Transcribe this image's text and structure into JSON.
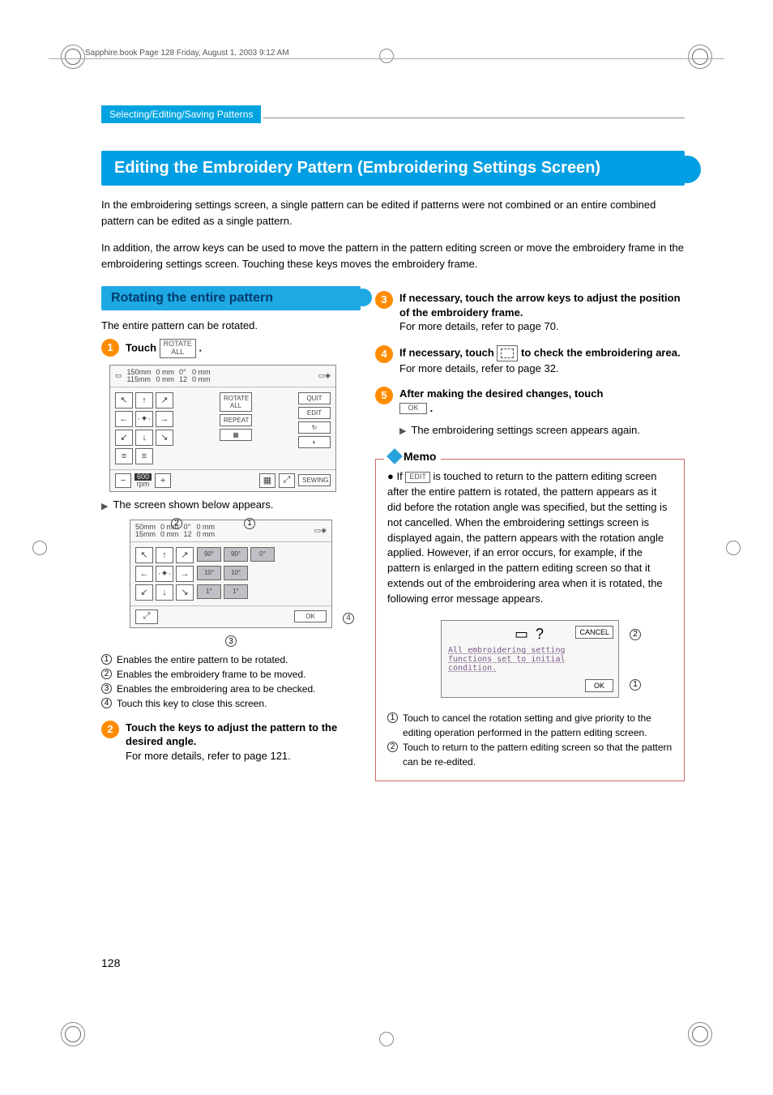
{
  "header": {
    "meta_line": "Sapphire.book  Page 128  Friday, August 1, 2003  9:12 AM",
    "section": "Selecting/Editing/Saving Patterns"
  },
  "title": "Editing the Embroidery Pattern (Embroidering Settings Screen)",
  "intro1": "In the embroidering settings screen, a single pattern can be edited if patterns were not combined or an entire combined pattern can be edited as a single pattern.",
  "intro2": "In addition, the arrow keys can be used to move the pattern in the pattern editing screen or move the embroidery frame in the embroidering settings screen. Touching these keys moves the embroidery frame.",
  "subheading": "Rotating the entire pattern",
  "sub_lead": "The entire pattern can be rotated.",
  "steps": {
    "s1": {
      "num": "1",
      "label": "Touch ",
      "key": "ROTATE\nALL",
      "period": "."
    },
    "s1_result": "The screen shown below appears.",
    "s2": {
      "num": "2",
      "bold": "Touch the keys to adjust the pattern to the desired angle.",
      "detail": "For more details, refer to page 121."
    },
    "s3": {
      "num": "3",
      "bold": "If necessary, touch the arrow keys to adjust the position of the embroidery frame.",
      "detail": "For more details, refer to page 70."
    },
    "s4": {
      "num": "4",
      "bold_a": "If necessary, touch ",
      "bold_b": " to check the embroidering area.",
      "detail": "For more details, refer to page 32."
    },
    "s5": {
      "num": "5",
      "bold_a": "After making the desired changes, touch ",
      "key": "OK",
      "period": ".",
      "result": "The embroidering settings screen appears again."
    }
  },
  "screenshot1": {
    "size1": "150mm",
    "size2": "115mm",
    "mm1": "0  mm",
    "mm2": "0  mm",
    "mm3": "0  mm",
    "mm4": "0  mm",
    "angle": "0°",
    "count": "12",
    "rotate_all": "ROTATE ALL",
    "repeat": "REPEAT",
    "quit": "QUIT",
    "edit": "EDIT",
    "sewing": "SEWING",
    "speed": "600",
    "rpm": "rpm"
  },
  "screenshot2": {
    "size1": "50mm",
    "size2": "15mm",
    "mm1": "0  mm",
    "mm2": "0  mm",
    "mm3": "0  mm",
    "mm4": "0  mm",
    "angle": "0°",
    "count": "12",
    "r90a": "90°",
    "r90b": "90°",
    "r10a": "10°",
    "r10b": "10°",
    "r1a": "1°",
    "r1b": "1°",
    "r0": "0°",
    "ok": "OK"
  },
  "callouts_a": {
    "c1": "Enables the entire pattern to be rotated.",
    "c2": "Enables the embroidery frame to be moved.",
    "c3": "Enables the embroidering area to be checked.",
    "c4": "Touch this key to close this screen."
  },
  "memo": {
    "label": "Memo",
    "lead_a": "If ",
    "key": "EDIT",
    "lead_b": " is touched to return to the pattern editing screen after the entire pattern is rotated, the pattern appears as it did before the rotation angle was specified, but the setting is not cancelled. When the embroidering settings screen is displayed again, the pattern appears with the rotation angle applied. However, if an error occurs, for example, if the pattern is enlarged in the pattern editing screen so that it extends out of the embroidering area when it is rotated, the following error message appears.",
    "error_msg_l1": "All embroidering setting",
    "error_msg_l2": "functions set to initial",
    "error_msg_l3": "condition.",
    "cancel": "CANCEL",
    "ok": "OK",
    "cb1": "Touch to cancel the rotation setting and give priority to the editing operation performed in the pattern editing screen.",
    "cb2": "Touch to return to the pattern editing screen so that the pattern can be re-edited."
  },
  "page_number": "128"
}
